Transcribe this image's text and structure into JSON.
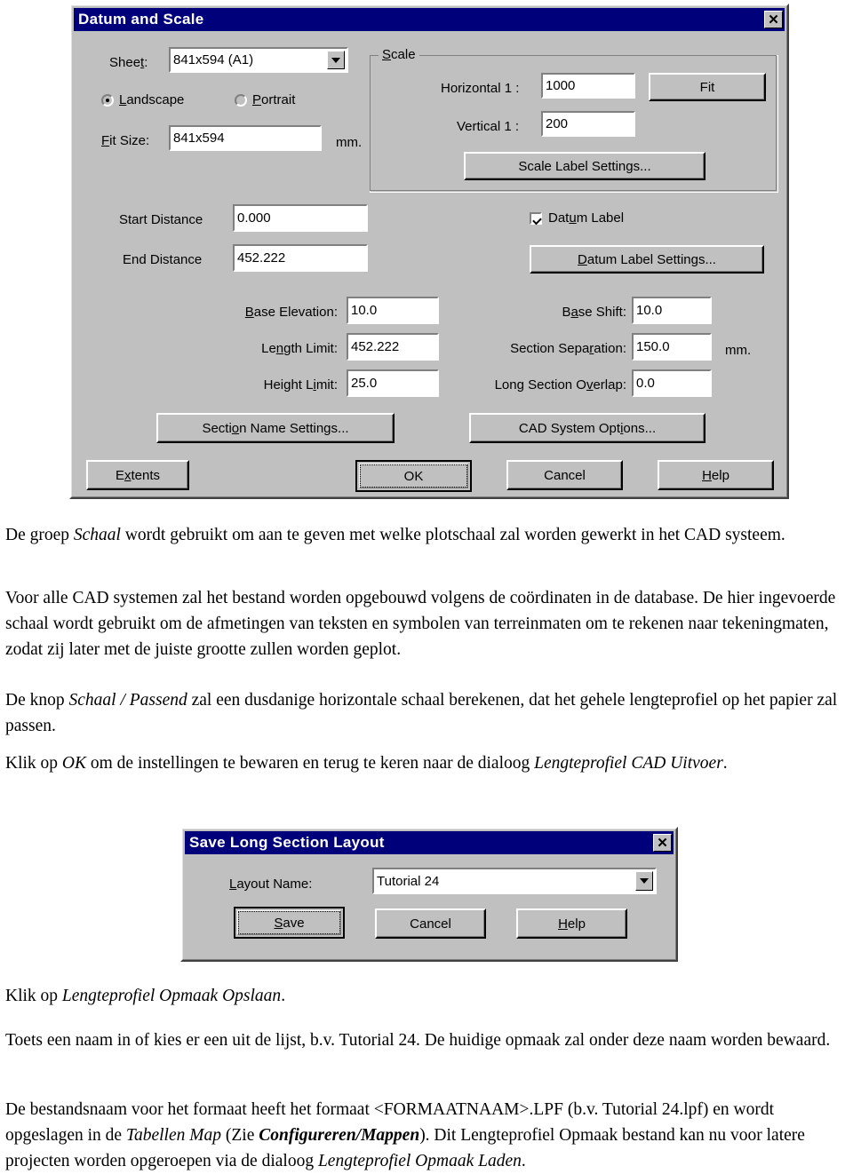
{
  "datum_dialog": {
    "title": "Datum and Scale",
    "close_label": "✕",
    "sheet_label": "Sheet:",
    "sheet_value": "841x594 (A1)",
    "orientation": {
      "landscape": "Landscape",
      "portrait": "Portrait",
      "selected": "Landscape"
    },
    "fit_size_label": "Fit Size:",
    "fit_size_value": "841x594",
    "fit_size_unit": "mm.",
    "scale_group": {
      "title": "Scale",
      "horizontal_label": "Horizontal 1 :",
      "horizontal_value": "1000",
      "vertical_label": "Vertical 1 :",
      "vertical_value": "200",
      "fit_button": "Fit",
      "scale_label_settings_button": "Scale Label Settings..."
    },
    "start_distance_label": "Start Distance",
    "start_distance_value": "0.000",
    "end_distance_label": "End Distance",
    "end_distance_value": "452.222",
    "datum_label_checkbox": "Datum Label",
    "datum_label_checked": true,
    "datum_label_settings_button": "Datum Label Settings...",
    "base_elevation_label": "Base Elevation:",
    "base_elevation_value": "10.0",
    "length_limit_label": "Length Limit:",
    "length_limit_value": "452.222",
    "height_limit_label": "Height Limit:",
    "height_limit_value": "25.0",
    "base_shift_label": "Base Shift:",
    "base_shift_value": "10.0",
    "section_separation_label": "Section Separation:",
    "section_separation_value": "150.0",
    "section_separation_unit": "mm.",
    "long_section_overlap_label": "Long Section Overlap:",
    "long_section_overlap_value": "0.0",
    "section_name_settings_button": "Section Name Settings...",
    "cad_system_options_button": "CAD System Options...",
    "extents_button": "Extents",
    "ok_button": "OK",
    "cancel_button": "Cancel",
    "help_button": "Help"
  },
  "save_dialog": {
    "title": "Save Long Section Layout",
    "close_label": "✕",
    "layout_name_label": "Layout Name:",
    "layout_name_value": "Tutorial 24",
    "save_button": "Save",
    "cancel_button": "Cancel",
    "help_button": "Help"
  },
  "body": {
    "p1": "De groep <i>Schaal</i> wordt gebruikt om aan te geven met welke plotschaal zal worden gewerkt in het CAD systeem.",
    "p2": "Voor alle CAD systemen zal het bestand worden opgebouwd volgens de coördinaten in de database. De hier ingevoerde schaal wordt gebruikt om de afmetingen van teksten en symbolen van terreinmaten om te rekenen naar tekeningmaten, zodat zij later met de juiste grootte zullen worden geplot.",
    "p3": "De knop <i>Schaal / Passend</i> zal een dusdanige horizontale schaal berekenen, dat het gehele lengteprofiel op het papier zal passen.",
    "p4": "Klik op <i>OK</i> om de instellingen te bewaren en terug te keren naar de dialoog <i>Lengteprofiel CAD Uitvoer</i>.",
    "p5": "Klik op <i>Lengteprofiel Opmaak Opslaan</i>.",
    "p6": "Toets een naam in of kies er een uit de lijst, b.v. Tutorial 24. De huidige opmaak zal onder deze naam worden bewaard.",
    "p7": "De bestandsnaam voor het formaat heeft het formaat &lt;FORMAATNAAM&gt;.LPF (b.v. Tutorial 24.lpf) en wordt opgeslagen in de <i>Tabellen Map</i> (Zie <b class=\"i\">Configureren/Mappen</b>). Dit Lengteprofiel Opmaak bestand kan nu voor latere projecten worden opgeroepen via de dialoog <i>Lengteprofiel Opmaak Laden</i>."
  },
  "colors": {
    "titlebar": "#00007b",
    "face": "#c0c0c0",
    "shadow": "#808080"
  }
}
